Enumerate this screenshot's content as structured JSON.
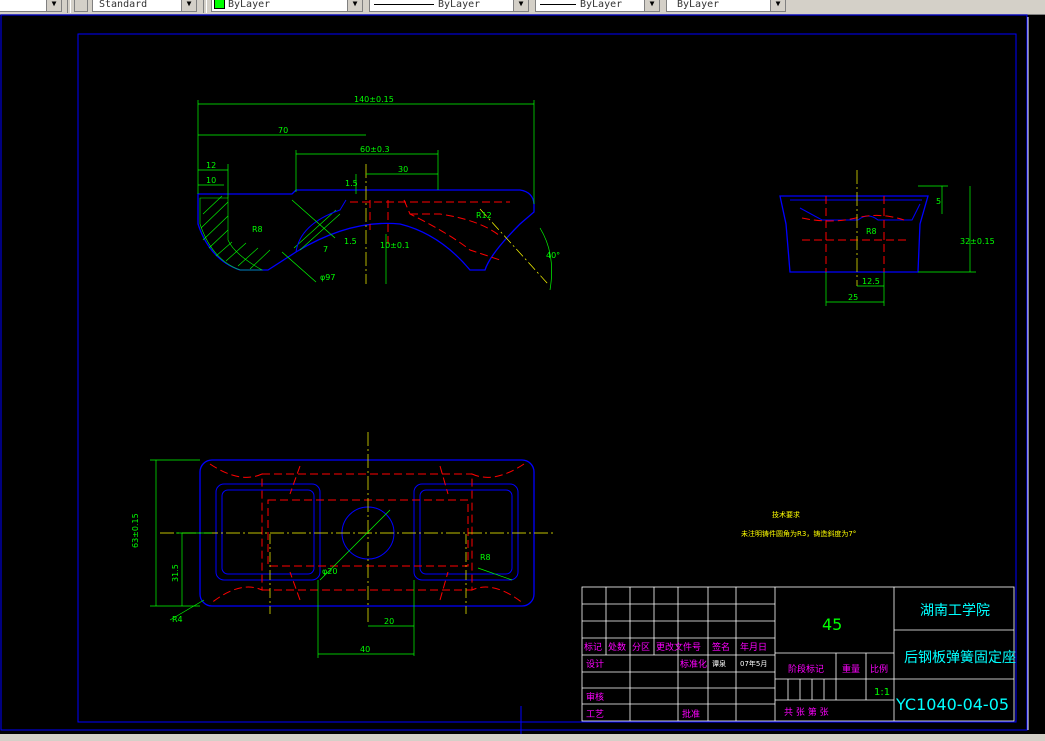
{
  "toolbar": {
    "textstyle": "Standard",
    "layer": "ByLayer",
    "linetype": "ByLayer",
    "lineweight": "ByLayer",
    "plotstyle": "ByLayer",
    "layer_color": "#00ff00"
  },
  "drawing": {
    "front_view_dims": {
      "overall": "140±0.15",
      "d70": "70",
      "d60": "60±0.3",
      "d30": "30",
      "d12": "12",
      "d10": "10",
      "r8": "R8",
      "d1_5a": "1.5",
      "d1_5b": "1.5",
      "d7": "7",
      "dia97": "φ97",
      "r12": "R12",
      "d10b": "10±0.1",
      "ang40": "40°"
    },
    "side_view_dims": {
      "d5": "5",
      "d32": "32±0.15",
      "r8": "R8",
      "d12_5": "12.5",
      "d25": "25"
    },
    "top_view_dims": {
      "d63": "63±0.15",
      "d31_5": "31.5",
      "dia20": "φ20",
      "r8": "R8",
      "r4": "R4",
      "d20": "20",
      "d40": "40"
    },
    "tech_req": {
      "title": "技术要求",
      "body": "未注明铸件圆角为R3，铸造斜度为7°"
    }
  },
  "title_block": {
    "material": "45",
    "school": "湖南工学院",
    "part_name": "后钢板弹簧固定座",
    "drawing_no": "YC1040-04-05",
    "scale": "1:1",
    "headers": [
      "标记",
      "处数",
      "分区",
      "更改文件号",
      "签名",
      "年月日"
    ],
    "design": "设计",
    "standardize": "标准化",
    "date": "07年5月",
    "stage_mark": "阶段标记",
    "weight": "重量",
    "scale_label": "比例",
    "review": "审核",
    "process": "工艺",
    "approve": "批准",
    "sheet": "共 张 第 张",
    "designer_sig": "谭泉"
  },
  "colors": {
    "outline": "#0000ff",
    "hidden": "#ff0000",
    "dimension": "#00ff00",
    "center": "#ffff00",
    "title_text": "#ff00ff"
  }
}
